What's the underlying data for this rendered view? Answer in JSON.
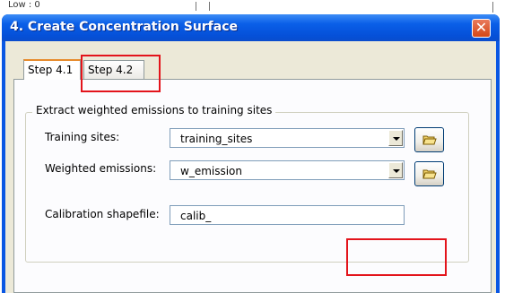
{
  "background": {
    "partial_text": "Low : 0"
  },
  "window": {
    "title": "4. Create Concentration Surface",
    "close_icon": "close-icon"
  },
  "tabs": [
    {
      "label": "Step 4.1",
      "selected": true
    },
    {
      "label": "Step 4.2",
      "selected": false
    }
  ],
  "group": {
    "title": "Extract weighted emissions to training sites"
  },
  "fields": {
    "training_sites": {
      "label": "Training sites:",
      "value": "training_sites"
    },
    "weighted_emissions": {
      "label": "Weighted emissions:",
      "value": "w_emission"
    },
    "calibration": {
      "label": "Calibration shapefile:",
      "value": "calib_"
    }
  },
  "icons": {
    "open": "open-folder-icon",
    "dropdown": "chevron-down-icon"
  },
  "colors": {
    "titlebar": "#0a5fe8",
    "highlight": "#e3141b",
    "dialog_bg": "#ece9d8"
  }
}
